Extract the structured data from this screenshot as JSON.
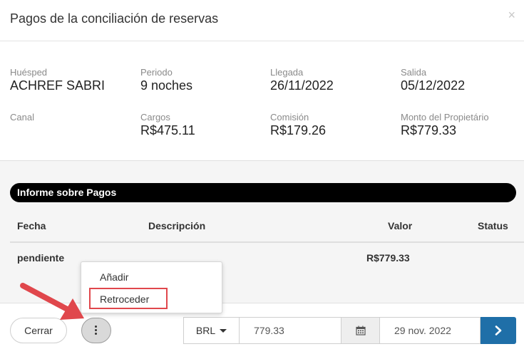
{
  "header": {
    "title": "Pagos de la conciliación de reservas",
    "close_glyph": "×"
  },
  "info": {
    "huesped": {
      "label": "Huésped",
      "value": "ACHREF SABRI"
    },
    "periodo": {
      "label": "Periodo",
      "value": "9 noches"
    },
    "llegada": {
      "label": "Llegada",
      "value": "26/11/2022"
    },
    "salida": {
      "label": "Salida",
      "value": "05/12/2022"
    },
    "canal": {
      "label": "Canal",
      "value": ""
    },
    "cargos": {
      "label": "Cargos",
      "value": "R$475.11"
    },
    "comision": {
      "label": "Comisión",
      "value": "R$179.26"
    },
    "monto": {
      "label": "Monto del Propietário",
      "value": "R$779.33"
    }
  },
  "payments": {
    "title": "Informe sobre Pagos",
    "columns": [
      "Fecha",
      "Descripción",
      "Valor",
      "Status"
    ],
    "rows": [
      {
        "fecha": "pendiente",
        "descripcion": "",
        "valor": "R$779.33",
        "status": ""
      }
    ]
  },
  "menu": {
    "items": [
      "Añadir",
      "Retroceder"
    ],
    "highlighted": "Retroceder"
  },
  "footer": {
    "close_label": "Cerrar",
    "currency": "BRL",
    "amount": "779.33",
    "date": "29 nov. 2022"
  },
  "colors": {
    "accent": "#1f6fa8",
    "highlight": "#e0474c",
    "pill": "#000000"
  },
  "icons": {
    "menu": "dots-vertical-icon",
    "calendar": "calendar-icon",
    "next": "chevron-right-icon"
  }
}
